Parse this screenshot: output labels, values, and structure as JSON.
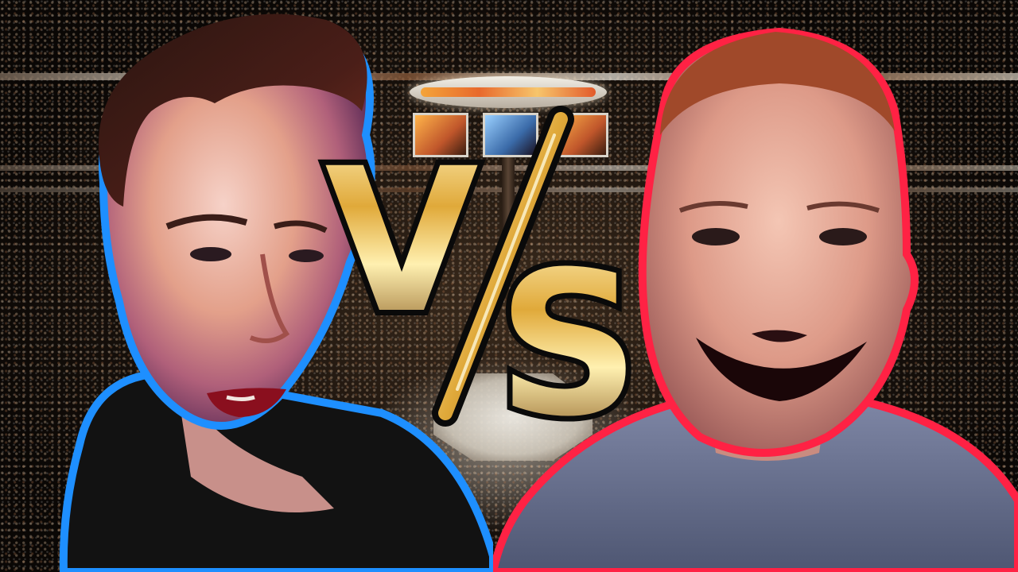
{
  "thumbnail": {
    "vs_text_v": "V",
    "vs_text_s": "S",
    "vs_divider": "/",
    "colors": {
      "left_outline": "#1e8fff",
      "right_outline": "#ff2244",
      "vs_gold_light": "#fff1b8",
      "vs_gold_mid": "#e0a93a",
      "vs_gold_dark": "#7a4a10",
      "vs_outline": "#0a0a0a",
      "arena_dark": "#1b130d"
    },
    "left_fighter": {
      "icon": "man-portrait-dark-hair-icon"
    },
    "right_fighter": {
      "icon": "man-portrait-short-red-hair-icon"
    },
    "background": {
      "icon": "arena-crowd-icon"
    }
  }
}
